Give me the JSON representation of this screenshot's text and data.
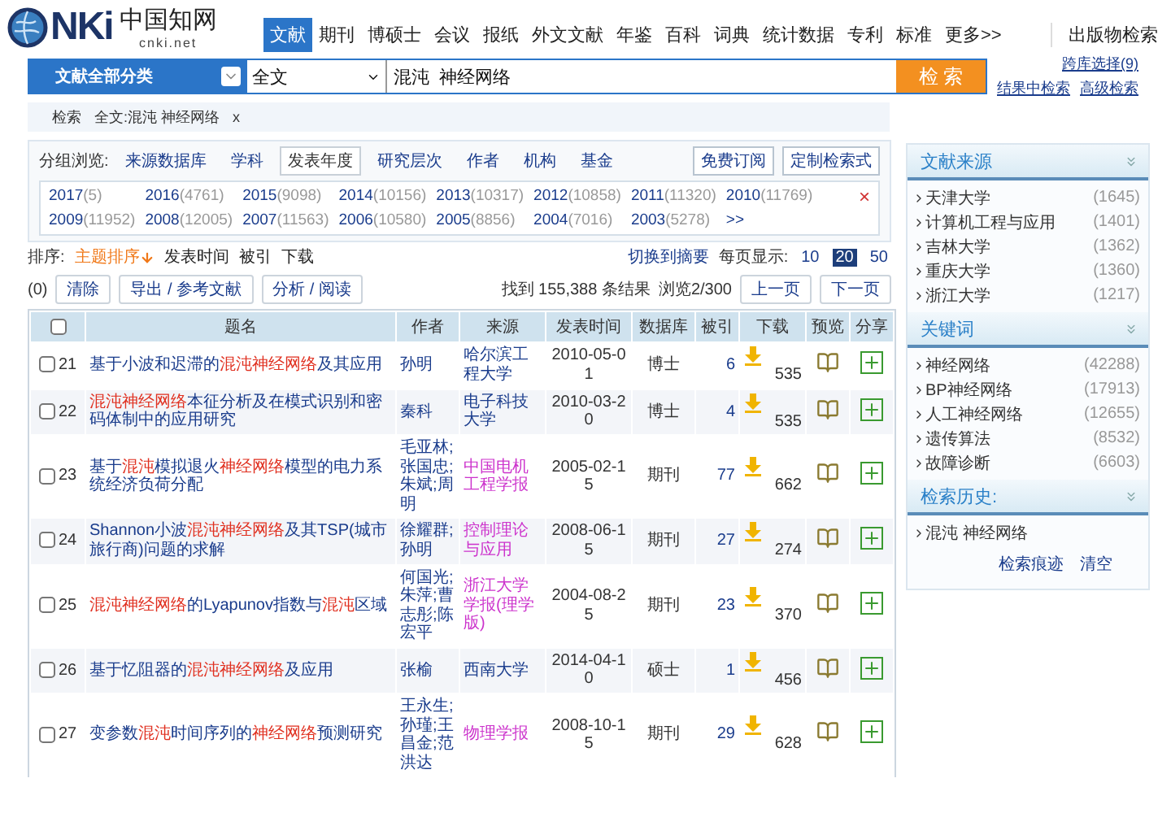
{
  "logo": {
    "latin": "NKi",
    "chinese": "中国知网",
    "domain": "cnki.net"
  },
  "nav": [
    {
      "label": "文献",
      "selected": true
    },
    {
      "label": "期刊",
      "selected": false
    },
    {
      "label": "博硕士",
      "selected": false
    },
    {
      "label": "会议",
      "selected": false
    },
    {
      "label": "报纸",
      "selected": false
    },
    {
      "label": "外文文献",
      "selected": false
    },
    {
      "label": "年鉴",
      "selected": false
    },
    {
      "label": "百科",
      "selected": false
    },
    {
      "label": "词典",
      "selected": false
    },
    {
      "label": "统计数据",
      "selected": false
    },
    {
      "label": "专利",
      "selected": false
    },
    {
      "label": "标准",
      "selected": false
    },
    {
      "label": "更多>>",
      "selected": false
    }
  ],
  "publication_search": "出版物检索",
  "search": {
    "category": "文献全部分类",
    "field": "全文",
    "value": "混沌  神经网络",
    "button": "检 索",
    "cross_db": "跨库选择(9)",
    "links": [
      "结果中检索",
      "高级检索"
    ]
  },
  "breadcrumb": {
    "label": "检索",
    "query": "全文:混沌 神经网络",
    "remove": "x"
  },
  "groups": {
    "label": "分组浏览:",
    "tabs": [
      {
        "label": "来源数据库",
        "selected": false
      },
      {
        "label": "学科",
        "selected": false
      },
      {
        "label": "发表年度",
        "selected": true
      },
      {
        "label": "研究层次",
        "selected": false
      },
      {
        "label": "作者",
        "selected": false
      },
      {
        "label": "机构",
        "selected": false
      },
      {
        "label": "基金",
        "selected": false
      }
    ],
    "buttons": [
      "免费订阅",
      "定制检索式"
    ],
    "years": [
      {
        "year": "2017",
        "count": "(5)"
      },
      {
        "year": "2016",
        "count": "(4761)"
      },
      {
        "year": "2015",
        "count": "(9098)"
      },
      {
        "year": "2014",
        "count": "(10156)"
      },
      {
        "year": "2013",
        "count": "(10317)"
      },
      {
        "year": "2012",
        "count": "(10858)"
      },
      {
        "year": "2011",
        "count": "(11320)"
      },
      {
        "year": "2010",
        "count": "(11769)"
      },
      {
        "year": "2009",
        "count": "(11952)"
      },
      {
        "year": "2008",
        "count": "(12005)"
      },
      {
        "year": "2007",
        "count": "(11563)"
      },
      {
        "year": "2006",
        "count": "(10580)"
      },
      {
        "year": "2005",
        "count": "(8856)"
      },
      {
        "year": "2004",
        "count": "(7016)"
      },
      {
        "year": "2003",
        "count": "(5278)"
      }
    ],
    "more": ">>",
    "close": "×"
  },
  "sort": {
    "label": "排序:",
    "options": [
      {
        "label": "主题排序",
        "selected": true
      },
      {
        "label": "发表时间",
        "selected": false
      },
      {
        "label": "被引",
        "selected": false
      },
      {
        "label": "下载",
        "selected": false
      }
    ],
    "switch": "切换到摘要",
    "per_page_label": "每页显示:",
    "per_page": [
      {
        "label": "10",
        "selected": false
      },
      {
        "label": "20",
        "selected": true
      },
      {
        "label": "50",
        "selected": false
      }
    ]
  },
  "actions": {
    "selected_count": "(0)",
    "buttons": [
      "清除",
      "导出 / 参考文献",
      "分析 / 阅读"
    ],
    "found": "找到 155,388 条结果",
    "page": "浏览2/300",
    "prev": "上一页",
    "next": "下一页"
  },
  "table": {
    "select_all": {
      "checked": false
    },
    "columns": [
      "题名",
      "作者",
      "来源",
      "发表时间",
      "数据库",
      "被引",
      "下载",
      "预览",
      "分享"
    ],
    "rows": [
      {
        "checked": false,
        "number": "21",
        "title": [
          {
            "text": "基于小波和迟滞的",
            "hit": false
          },
          {
            "text": "混沌神经网络",
            "hit": true
          },
          {
            "text": "及其应用",
            "hit": false
          }
        ],
        "author": "孙明",
        "source": "哈尔滨工程大学",
        "color": "#1a3c8c",
        "date": "2010-05-01",
        "database": "博士",
        "cited": "6",
        "downloads": "535"
      },
      {
        "checked": false,
        "number": "22",
        "title": [
          {
            "text": "混沌神经网络",
            "hit": true
          },
          {
            "text": "本征分析及在模式识别和密码体制中的应用研究",
            "hit": false
          }
        ],
        "author": "秦科",
        "source": "电子科技大学",
        "color": "#1a3c8c",
        "date": "2010-03-20",
        "database": "博士",
        "cited": "4",
        "downloads": "535"
      },
      {
        "checked": false,
        "number": "23",
        "title": [
          {
            "text": "基于",
            "hit": false
          },
          {
            "text": "混沌",
            "hit": true
          },
          {
            "text": "模拟退火",
            "hit": false
          },
          {
            "text": "神经网络",
            "hit": true
          },
          {
            "text": "模型的电力系统经济负荷分配",
            "hit": false
          }
        ],
        "author": "毛亚林;张国忠;朱斌;周明",
        "source": "中国电机工程学报",
        "color": "#cc33cc",
        "date": "2005-02-15",
        "database": "期刊",
        "cited": "77",
        "downloads": "662"
      },
      {
        "checked": false,
        "number": "24",
        "title": [
          {
            "text": "Shannon小波",
            "hit": false
          },
          {
            "text": "混沌神经网络",
            "hit": true
          },
          {
            "text": "及其TSP(城市旅行商)问题的求解",
            "hit": false
          }
        ],
        "author": "徐耀群;孙明",
        "source": "控制理论与应用",
        "color": "#cc33cc",
        "date": "2008-06-15",
        "database": "期刊",
        "cited": "27",
        "downloads": "274"
      },
      {
        "checked": false,
        "number": "25",
        "title": [
          {
            "text": "混沌神经网络",
            "hit": true
          },
          {
            "text": "的Lyapunov指数与",
            "hit": false
          },
          {
            "text": "混沌",
            "hit": true
          },
          {
            "text": "区域",
            "hit": false
          }
        ],
        "author": "何国光;朱萍;曹志彤;陈宏平",
        "source": "浙江大学学报(理学版)",
        "color": "#cc33cc",
        "date": "2004-08-25",
        "database": "期刊",
        "cited": "23",
        "downloads": "370"
      },
      {
        "checked": false,
        "number": "26",
        "title": [
          {
            "text": "基于忆阻器的",
            "hit": false
          },
          {
            "text": "混沌神经网络",
            "hit": true
          },
          {
            "text": "及应用",
            "hit": false
          }
        ],
        "author": "张榆",
        "source": "西南大学",
        "color": "#1a3c8c",
        "date": "2014-04-10",
        "database": "硕士",
        "cited": "1",
        "downloads": "456"
      },
      {
        "checked": false,
        "number": "27",
        "title": [
          {
            "text": "变参数",
            "hit": false
          },
          {
            "text": "混沌",
            "hit": true
          },
          {
            "text": "时间序列的",
            "hit": false
          },
          {
            "text": "神经网络",
            "hit": true
          },
          {
            "text": "预测研究",
            "hit": false
          }
        ],
        "author": "王永生;孙瑾;王昌金;范洪达",
        "source": "物理学报",
        "color": "#cc33cc",
        "date": "2008-10-15",
        "database": "期刊",
        "cited": "29",
        "downloads": "628"
      }
    ]
  },
  "sidebar": {
    "panels": [
      {
        "title": "文献来源",
        "items": [
          {
            "label": "天津大学",
            "count": "(1645)"
          },
          {
            "label": "计算机工程与应用",
            "count": "(1401)"
          },
          {
            "label": "吉林大学",
            "count": "(1362)"
          },
          {
            "label": "重庆大学",
            "count": "(1360)"
          },
          {
            "label": "浙江大学",
            "count": "(1217)"
          }
        ]
      },
      {
        "title": "关键词",
        "items": [
          {
            "label": "神经网络",
            "count": "(42288)"
          },
          {
            "label": "BP神经网络",
            "count": "(17913)"
          },
          {
            "label": "人工神经网络",
            "count": "(12655)"
          },
          {
            "label": "遗传算法",
            "count": "(8532)"
          },
          {
            "label": "故障诊断",
            "count": "(6603)"
          }
        ]
      },
      {
        "title": "检索历史:",
        "items": [
          {
            "label": "混沌  神经网络"
          }
        ],
        "links": [
          "检索痕迹",
          "清空"
        ]
      }
    ]
  }
}
